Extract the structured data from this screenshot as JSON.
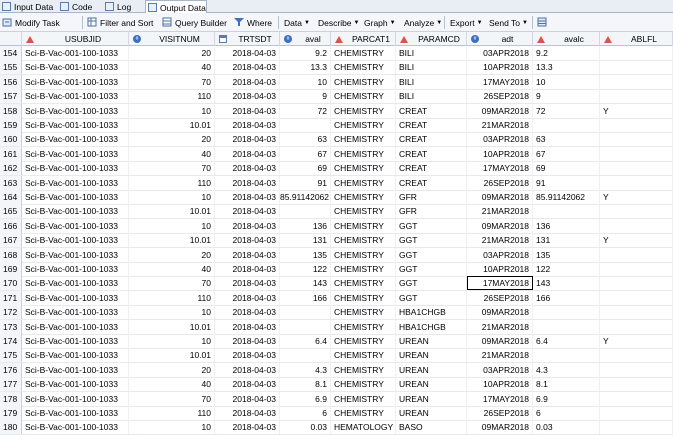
{
  "tabs": [
    "Input Data",
    "Code",
    "Log",
    "Output Data"
  ],
  "toolbar": {
    "modify_task": "Modify Task",
    "filter_sort": "Filter and Sort",
    "query_builder": "Query Builder",
    "where": "Where",
    "data": "Data",
    "describe": "Describe",
    "graph": "Graph",
    "analyze": "Analyze",
    "export": "Export",
    "send_to": "Send To"
  },
  "columns": [
    "USUBJID",
    "VISITNUM",
    "TRTSDT",
    "aval",
    "PARCAT1",
    "PARAMCD",
    "adt",
    "avalc",
    "ABLFL"
  ],
  "rows": [
    {
      "n": "154",
      "usubjid": "Sci-B-Vac-001-100-1033",
      "visitnum": "20",
      "trtsdt": "2018-04-03",
      "aval": "9.2",
      "parcat1": "CHEMISTRY",
      "paramcd": "BILI",
      "adt": "03APR2018",
      "avalc": "9.2",
      "ablfl": ""
    },
    {
      "n": "155",
      "usubjid": "Sci-B-Vac-001-100-1033",
      "visitnum": "40",
      "trtsdt": "2018-04-03",
      "aval": "13.3",
      "parcat1": "CHEMISTRY",
      "paramcd": "BILI",
      "adt": "10APR2018",
      "avalc": "13.3",
      "ablfl": ""
    },
    {
      "n": "156",
      "usubjid": "Sci-B-Vac-001-100-1033",
      "visitnum": "70",
      "trtsdt": "2018-04-03",
      "aval": "10",
      "parcat1": "CHEMISTRY",
      "paramcd": "BILI",
      "adt": "17MAY2018",
      "avalc": "10",
      "ablfl": ""
    },
    {
      "n": "157",
      "usubjid": "Sci-B-Vac-001-100-1033",
      "visitnum": "110",
      "trtsdt": "2018-04-03",
      "aval": "9",
      "parcat1": "CHEMISTRY",
      "paramcd": "BILI",
      "adt": "26SEP2018",
      "avalc": "9",
      "ablfl": ""
    },
    {
      "n": "158",
      "usubjid": "Sci-B-Vac-001-100-1033",
      "visitnum": "10",
      "trtsdt": "2018-04-03",
      "aval": "72",
      "parcat1": "CHEMISTRY",
      "paramcd": "CREAT",
      "adt": "09MAR2018",
      "avalc": "72",
      "ablfl": "Y"
    },
    {
      "n": "159",
      "usubjid": "Sci-B-Vac-001-100-1033",
      "visitnum": "10.01",
      "trtsdt": "2018-04-03",
      "aval": "",
      "parcat1": "CHEMISTRY",
      "paramcd": "CREAT",
      "adt": "21MAR2018",
      "avalc": "",
      "ablfl": ""
    },
    {
      "n": "160",
      "usubjid": "Sci-B-Vac-001-100-1033",
      "visitnum": "20",
      "trtsdt": "2018-04-03",
      "aval": "63",
      "parcat1": "CHEMISTRY",
      "paramcd": "CREAT",
      "adt": "03APR2018",
      "avalc": "63",
      "ablfl": ""
    },
    {
      "n": "161",
      "usubjid": "Sci-B-Vac-001-100-1033",
      "visitnum": "40",
      "trtsdt": "2018-04-03",
      "aval": "67",
      "parcat1": "CHEMISTRY",
      "paramcd": "CREAT",
      "adt": "10APR2018",
      "avalc": "67",
      "ablfl": ""
    },
    {
      "n": "162",
      "usubjid": "Sci-B-Vac-001-100-1033",
      "visitnum": "70",
      "trtsdt": "2018-04-03",
      "aval": "69",
      "parcat1": "CHEMISTRY",
      "paramcd": "CREAT",
      "adt": "17MAY2018",
      "avalc": "69",
      "ablfl": ""
    },
    {
      "n": "163",
      "usubjid": "Sci-B-Vac-001-100-1033",
      "visitnum": "110",
      "trtsdt": "2018-04-03",
      "aval": "91",
      "parcat1": "CHEMISTRY",
      "paramcd": "CREAT",
      "adt": "26SEP2018",
      "avalc": "91",
      "ablfl": ""
    },
    {
      "n": "164",
      "usubjid": "Sci-B-Vac-001-100-1033",
      "visitnum": "10",
      "trtsdt": "2018-04-03",
      "aval": "85.91142062",
      "parcat1": "CHEMISTRY",
      "paramcd": "GFR",
      "adt": "09MAR2018",
      "avalc": "85.91142062",
      "ablfl": "Y"
    },
    {
      "n": "165",
      "usubjid": "Sci-B-Vac-001-100-1033",
      "visitnum": "10.01",
      "trtsdt": "2018-04-03",
      "aval": "",
      "parcat1": "CHEMISTRY",
      "paramcd": "GFR",
      "adt": "21MAR2018",
      "avalc": "",
      "ablfl": ""
    },
    {
      "n": "166",
      "usubjid": "Sci-B-Vac-001-100-1033",
      "visitnum": "10",
      "trtsdt": "2018-04-03",
      "aval": "136",
      "parcat1": "CHEMISTRY",
      "paramcd": "GGT",
      "adt": "09MAR2018",
      "avalc": "136",
      "ablfl": ""
    },
    {
      "n": "167",
      "usubjid": "Sci-B-Vac-001-100-1033",
      "visitnum": "10.01",
      "trtsdt": "2018-04-03",
      "aval": "131",
      "parcat1": "CHEMISTRY",
      "paramcd": "GGT",
      "adt": "21MAR2018",
      "avalc": "131",
      "ablfl": "Y"
    },
    {
      "n": "168",
      "usubjid": "Sci-B-Vac-001-100-1033",
      "visitnum": "20",
      "trtsdt": "2018-04-03",
      "aval": "135",
      "parcat1": "CHEMISTRY",
      "paramcd": "GGT",
      "adt": "03APR2018",
      "avalc": "135",
      "ablfl": ""
    },
    {
      "n": "169",
      "usubjid": "Sci-B-Vac-001-100-1033",
      "visitnum": "40",
      "trtsdt": "2018-04-03",
      "aval": "122",
      "parcat1": "CHEMISTRY",
      "paramcd": "GGT",
      "adt": "10APR2018",
      "avalc": "122",
      "ablfl": ""
    },
    {
      "n": "170",
      "usubjid": "Sci-B-Vac-001-100-1033",
      "visitnum": "70",
      "trtsdt": "2018-04-03",
      "aval": "143",
      "parcat1": "CHEMISTRY",
      "paramcd": "GGT",
      "adt": "17MAY2018",
      "avalc": "143",
      "ablfl": "",
      "selected": true
    },
    {
      "n": "171",
      "usubjid": "Sci-B-Vac-001-100-1033",
      "visitnum": "110",
      "trtsdt": "2018-04-03",
      "aval": "166",
      "parcat1": "CHEMISTRY",
      "paramcd": "GGT",
      "adt": "26SEP2018",
      "avalc": "166",
      "ablfl": ""
    },
    {
      "n": "172",
      "usubjid": "Sci-B-Vac-001-100-1033",
      "visitnum": "10",
      "trtsdt": "2018-04-03",
      "aval": "",
      "parcat1": "CHEMISTRY",
      "paramcd": "HBA1CHGB",
      "adt": "09MAR2018",
      "avalc": "",
      "ablfl": ""
    },
    {
      "n": "173",
      "usubjid": "Sci-B-Vac-001-100-1033",
      "visitnum": "10.01",
      "trtsdt": "2018-04-03",
      "aval": "",
      "parcat1": "CHEMISTRY",
      "paramcd": "HBA1CHGB",
      "adt": "21MAR2018",
      "avalc": "",
      "ablfl": ""
    },
    {
      "n": "174",
      "usubjid": "Sci-B-Vac-001-100-1033",
      "visitnum": "10",
      "trtsdt": "2018-04-03",
      "aval": "6.4",
      "parcat1": "CHEMISTRY",
      "paramcd": "UREAN",
      "adt": "09MAR2018",
      "avalc": "6.4",
      "ablfl": "Y"
    },
    {
      "n": "175",
      "usubjid": "Sci-B-Vac-001-100-1033",
      "visitnum": "10.01",
      "trtsdt": "2018-04-03",
      "aval": "",
      "parcat1": "CHEMISTRY",
      "paramcd": "UREAN",
      "adt": "21MAR2018",
      "avalc": "",
      "ablfl": ""
    },
    {
      "n": "176",
      "usubjid": "Sci-B-Vac-001-100-1033",
      "visitnum": "20",
      "trtsdt": "2018-04-03",
      "aval": "4.3",
      "parcat1": "CHEMISTRY",
      "paramcd": "UREAN",
      "adt": "03APR2018",
      "avalc": "4.3",
      "ablfl": ""
    },
    {
      "n": "177",
      "usubjid": "Sci-B-Vac-001-100-1033",
      "visitnum": "40",
      "trtsdt": "2018-04-03",
      "aval": "8.1",
      "parcat1": "CHEMISTRY",
      "paramcd": "UREAN",
      "adt": "10APR2018",
      "avalc": "8.1",
      "ablfl": ""
    },
    {
      "n": "178",
      "usubjid": "Sci-B-Vac-001-100-1033",
      "visitnum": "70",
      "trtsdt": "2018-04-03",
      "aval": "6.9",
      "parcat1": "CHEMISTRY",
      "paramcd": "UREAN",
      "adt": "17MAY2018",
      "avalc": "6.9",
      "ablfl": ""
    },
    {
      "n": "179",
      "usubjid": "Sci-B-Vac-001-100-1033",
      "visitnum": "110",
      "trtsdt": "2018-04-03",
      "aval": "6",
      "parcat1": "CHEMISTRY",
      "paramcd": "UREAN",
      "adt": "26SEP2018",
      "avalc": "6",
      "ablfl": ""
    },
    {
      "n": "180",
      "usubjid": "Sci-B-Vac-001-100-1033",
      "visitnum": "10",
      "trtsdt": "2018-04-03",
      "aval": "0.03",
      "parcat1": "HEMATOLOGY",
      "paramcd": "BASO",
      "adt": "09MAR2018",
      "avalc": "0.03",
      "ablfl": ""
    }
  ]
}
